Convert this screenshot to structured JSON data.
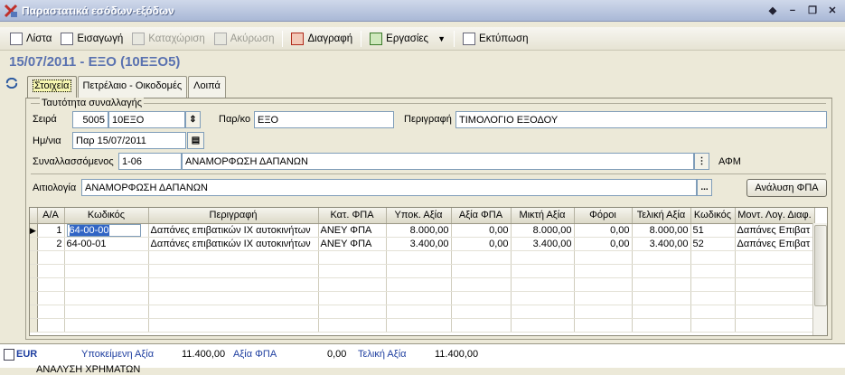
{
  "window": {
    "title": "Παραστατικά εσόδων-εξόδων"
  },
  "toolbar": {
    "list": "Λίστα",
    "insert": "Εισαγωγή",
    "register": "Καταχώριση",
    "cancel": "Ακύρωση",
    "delete": "Διαγραφή",
    "tasks": "Εργασίες",
    "print": "Εκτύπωση"
  },
  "heading": "15/07/2011 - ΕΞΟ (10ΕΞΟ5)",
  "tabs": [
    "Στοιχεία",
    "Πετρέλαιο - Οικοδομές",
    "Λοιπά"
  ],
  "form": {
    "group_title": "Ταυτότητα συναλλαγής",
    "series_label": "Σειρά",
    "series_code": "5005",
    "series_name": "10ΕΞΟ",
    "parko_label": "Παρ/κο",
    "parko_value": "ΕΞΟ",
    "descr_label": "Περιγραφή",
    "descr_value": "ΤΙΜΟΛΟΓΙΟ ΕΞΟΔΟΥ",
    "date_label": "Ημ/νια",
    "date_value": "Παρ 15/07/2011",
    "partner_label": "Συναλλασσόμενος",
    "partner_code": "1-06",
    "partner_name": "ΑΝΑΜΟΡΦΩΣΗ ΔΑΠΑΝΩΝ",
    "afm_label": "ΑΦΜ",
    "reason_label": "Αιτιολογία",
    "reason_value": "ΑΝΑΜΟΡΦΩΣΗ ΔΑΠΑΝΩΝ",
    "ellipsis": "...",
    "vat_button": "Ανάλυση ΦΠΑ"
  },
  "grid": {
    "headers": [
      "Α/Α",
      "Κωδικός",
      "Περιγραφή",
      "Κατ. ΦΠΑ",
      "Υποκ. Αξία",
      "Αξία ΦΠΑ",
      "Μικτή Αξία",
      "Φόροι",
      "Τελική Αξία",
      "Κωδικός",
      "Μοντ. Λογ. Διαφ."
    ],
    "rows": [
      {
        "aa": "1",
        "code": "64-00-00",
        "descr": "Δαπάνες επιβατικών IX αυτοκινήτων",
        "vatcat": "ΑΝΕΥ ΦΠΑ",
        "net": "8.000,00",
        "vat": "0,00",
        "gross": "8.000,00",
        "taxes": "0,00",
        "total": "8.000,00",
        "code2": "51",
        "model": "Δαπάνες Επιβατ"
      },
      {
        "aa": "2",
        "code": "64-00-01",
        "descr": "Δαπάνες επιβατικών IX αυτοκινήτων",
        "vatcat": "ΑΝΕΥ ΦΠΑ",
        "net": "3.400,00",
        "vat": "0,00",
        "gross": "3.400,00",
        "taxes": "0,00",
        "total": "3.400,00",
        "code2": "52",
        "model": "Δαπάνες Επιβατ"
      }
    ]
  },
  "footer": {
    "currency": "EUR",
    "net_label": "Υποκείμενη Αξία",
    "net_value": "11.400,00",
    "vat_label": "Αξία ΦΠΑ",
    "vat_value": "0,00",
    "total_label": "Τελική Αξία",
    "total_value": "11.400,00",
    "cut_text": "ΑΝΑΛΥΣΗ ΧΡΗΜΑΤΩΝ"
  },
  "colors": {
    "heading": "#5a72b0",
    "footer_labels": "#1f3fa0",
    "selection": "#3165c5"
  }
}
